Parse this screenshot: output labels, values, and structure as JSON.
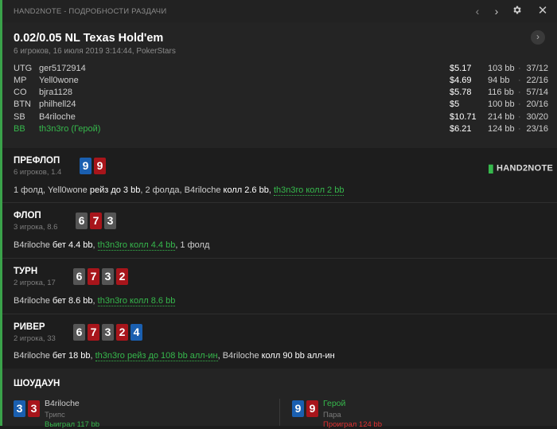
{
  "window": {
    "title": "HAND2NOTE - ПОДРОБНОСТИ РАЗДАЧИ",
    "back_icon": "chevron-left-icon",
    "forward_icon": "chevron-right-icon",
    "settings_icon": "gear-icon",
    "close_icon": "close-icon"
  },
  "colors": {
    "hero": "#36b84c",
    "red_card": "#a8151b",
    "blue_card": "#1a5fb0",
    "gray_card": "#555555",
    "lose": "#e03030"
  },
  "header": {
    "game": "0.02/0.05 NL Texas Hold'em",
    "subtitle": "6 игроков, 16 июля 2019 3:14:44, PokerStars",
    "next_icon": "chevron-right-icon"
  },
  "players": [
    {
      "pos": "UTG",
      "name": "ger5172914",
      "stack": "$5.17",
      "bb": "103 bb",
      "dot": "·",
      "hands": "37/12"
    },
    {
      "pos": "MP",
      "name": "Yell0wone",
      "stack": "$4.69",
      "bb": "94 bb",
      "dot": "·",
      "hands": "22/16"
    },
    {
      "pos": "CO",
      "name": "bjra1128",
      "stack": "$5.78",
      "bb": "116 bb",
      "dot": "·",
      "hands": "57/14"
    },
    {
      "pos": "BTN",
      "name": "philhell24",
      "stack": "$5",
      "bb": "100 bb",
      "dot": "·",
      "hands": "20/16"
    },
    {
      "pos": "SB",
      "name": "B4riloche",
      "stack": "$10.71",
      "bb": "214 bb",
      "dot": "·",
      "hands": "30/20"
    },
    {
      "pos": "BB",
      "name": "th3n3ro (Герой)",
      "stack": "$6.21",
      "bb": "124 bb",
      "dot": "·",
      "hands": "23/16"
    }
  ],
  "preflop": {
    "name": "ПРЕФЛОП",
    "sub": "6 игроков, 1.4",
    "cards": [
      "9",
      "9"
    ],
    "brand": "HAND2NOTE",
    "a1": "1 фолд, Yell0wone ",
    "a2": "рейз до 3 bb",
    "a3": ", 2 фолда, B4riloche ",
    "a4": "колл 2.6 bb",
    "a5": ", ",
    "a6": "th3n3ro колл 2 bb"
  },
  "flop": {
    "name": "ФЛОП",
    "sub": "3 игрока, 8.6",
    "cards": [
      "6",
      "7",
      "3"
    ],
    "a1": "B4riloche ",
    "a2": "бет 4.4 bb",
    "a3": ", ",
    "a4": "th3n3ro колл 4.4 bb",
    "a5": ", 1 фолд"
  },
  "turn": {
    "name": "ТУРН",
    "sub": "2 игрока, 17",
    "cards": [
      "6",
      "7",
      "3",
      "2"
    ],
    "a1": "B4riloche ",
    "a2": "бет 8.6 bb",
    "a3": ", ",
    "a4": "th3n3ro колл 8.6 bb"
  },
  "river": {
    "name": "РИВЕР",
    "sub": "2 игрока, 33",
    "cards": [
      "6",
      "7",
      "3",
      "2",
      "4"
    ],
    "a1": "B4riloche ",
    "a2": "бет 18 bb",
    "a3": ", ",
    "a4": "th3n3ro рейз до 108 bb алл-ин",
    "a5": ", B4riloche ",
    "a6": "колл 90 bb алл-ин"
  },
  "showdown": {
    "title": "ШОУДАУН",
    "p1": {
      "cards": [
        "3",
        "3"
      ],
      "name": "B4riloche",
      "combo": "Трипс",
      "result": "Выиграл 117 bb"
    },
    "p2": {
      "cards": [
        "9",
        "9"
      ],
      "name": "Герой",
      "combo": "Пара",
      "result": "Проиграл 124 bb"
    }
  }
}
